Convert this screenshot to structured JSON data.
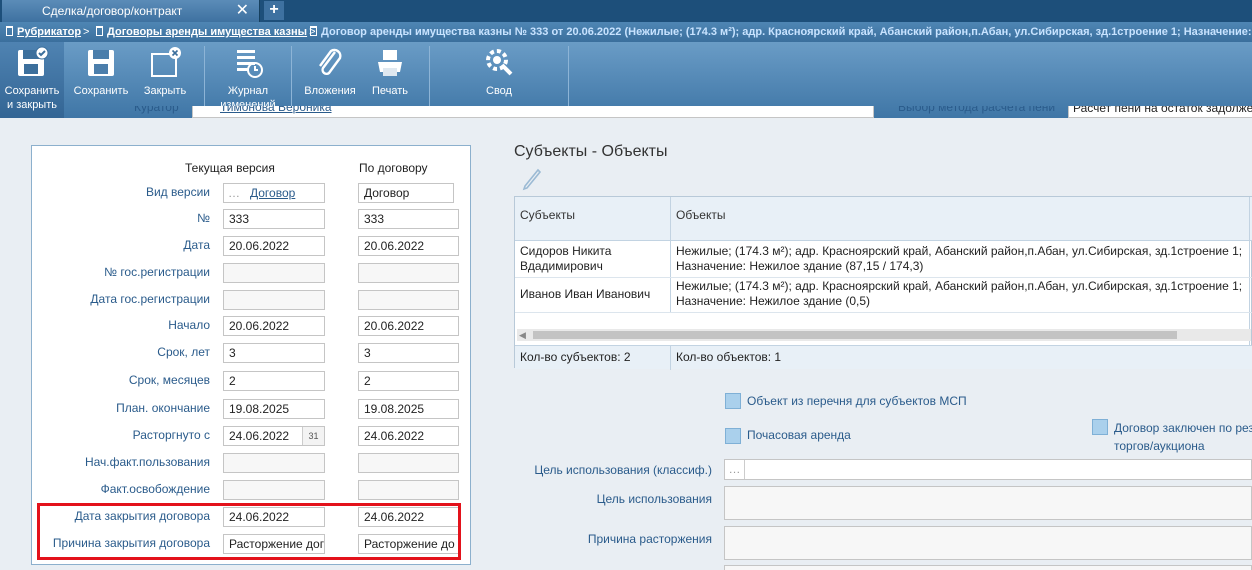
{
  "tab": {
    "title": "Сделка/договор/контракт",
    "close": "✕",
    "add": "+"
  },
  "breadcrumb": {
    "items": [
      {
        "label": "Рубрикатор"
      },
      {
        "label": "Договоры аренды имущества казны"
      }
    ],
    "current": "Договор аренды имущества казны № 333 от 20.06.2022 (Нежилые; (174.3 м²); адр. Красноярский край, Абанский район,п.Абан, ул.Сибирская, зд.1строение 1; Назначение: Нежилое",
    "sep": ">"
  },
  "toolbar": {
    "save_close": [
      "Сохранить",
      "и закрыть"
    ],
    "save": "Сохранить",
    "close": "Закрыть",
    "journal": [
      "Журнал",
      "изменений"
    ],
    "attachments": "Вложения",
    "print": "Печать",
    "summary": "Свод"
  },
  "obscured": {
    "curator_label": "Куратор",
    "curator_value": "Тимонова Вероника",
    "method_label": "Выбор метода расчета пени",
    "method_value": "Расчет пени на остаток задолже"
  },
  "version_panel": {
    "col_current": "Текущая версия",
    "col_contract": "По договору",
    "rows": [
      {
        "label": "Вид версии",
        "current": "Договор",
        "contract": "Договор"
      },
      {
        "label": "№",
        "current": "333",
        "contract": "333"
      },
      {
        "label": "Дата",
        "current": "20.06.2022",
        "contract": "20.06.2022"
      },
      {
        "label": "№ гос.регистрации",
        "current": "",
        "contract": ""
      },
      {
        "label": "Дата гос.регистрации",
        "current": "",
        "contract": ""
      },
      {
        "label": "Начало",
        "current": "20.06.2022",
        "contract": "20.06.2022"
      },
      {
        "label": "Срок, лет",
        "current": "3",
        "contract": "3"
      },
      {
        "label": "Срок, месяцев",
        "current": "2",
        "contract": "2"
      },
      {
        "label": "План. окончание",
        "current": "19.08.2025",
        "contract": "19.08.2025"
      },
      {
        "label": "Расторгнуто с",
        "current": "24.06.2022",
        "contract": "24.06.2022"
      },
      {
        "label": "Нач.факт.пользования",
        "current": "",
        "contract": ""
      },
      {
        "label": "Факт.освобождение",
        "current": "",
        "contract": ""
      },
      {
        "label": "Дата закрытия договора",
        "current": "24.06.2022",
        "contract": "24.06.2022"
      },
      {
        "label": "Причина закрытия договора",
        "current": "Расторжение дог",
        "contract": "Расторжение до"
      }
    ],
    "calendar_icon": "31"
  },
  "subjects": {
    "title": "Субъекты - Объекты",
    "col_subjects": "Субъекты",
    "col_objects": "Объекты",
    "rows": [
      {
        "subject": [
          "Сидоров Никита",
          "Вдадимирович"
        ],
        "object": [
          "Нежилые; (174.3 м²); адр. Красноярский край, Абанский район,п.Абан, ул.Сибирская, зд.1строение 1;",
          "Назначение: Нежилое здание (87,15 / 174,3)"
        ]
      },
      {
        "subject": [
          "Иванов Иван Иванович"
        ],
        "object": [
          "Нежилые; (174.3 м²); адр. Красноярский край, Абанский район,п.Абан, ул.Сибирская, зд.1строение 1;",
          "Назначение: Нежилое здание (0,5)"
        ]
      }
    ],
    "footer_subjects": "Кол-во субъектов: 2",
    "footer_objects": "Кол-во объектов: 1"
  },
  "options": {
    "msp": "Объект из перечня для субъектов МСП",
    "hourly": "Почасовая аренда",
    "auction": [
      "Договор заключен по рез",
      "торгов/аукциона"
    ]
  },
  "usage": {
    "classif_label": "Цель использования (классиф.)",
    "usage_label": "Цель использования",
    "termination_label": "Причина расторжения"
  }
}
